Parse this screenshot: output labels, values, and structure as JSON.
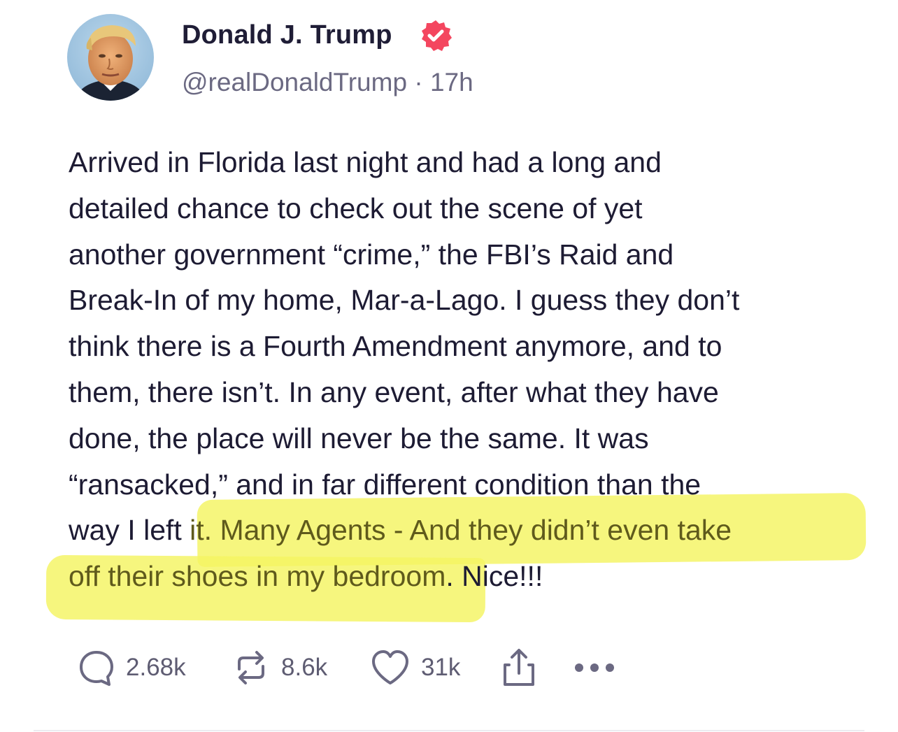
{
  "author": {
    "name": "Donald J. Trump",
    "handle": "@realDonaldTrump",
    "separator": "·",
    "time": "17h",
    "verified": true,
    "avatar": "profile-photo"
  },
  "post": {
    "lines": [
      "Arrived in Florida last night and had a long and",
      "detailed chance to check out the scene of yet",
      "another government “crime,” the FBI’s Raid and",
      "Break-In of my home, Mar-a-Lago. I guess they don’t",
      "think there is a Fourth Amendment anymore, and to",
      "them, there isn’t. In any event, after what they have",
      "done, the place will never be the same. It was",
      "“ransacked,” and in far different condition than the"
    ],
    "line9_plain": "way I left ",
    "line9_highlight": "it. Many Agents - And they didn’t even take",
    "line10_highlight": "off their shoes in my bedroom",
    "line10_plain": ". Nice!!!",
    "highlight_color": "#f4f462"
  },
  "actions": {
    "reply": {
      "icon": "reply-bubble-icon",
      "count": "2.68k"
    },
    "repost": {
      "icon": "repost-icon",
      "count": "8.6k"
    },
    "like": {
      "icon": "heart-icon",
      "count": "31k"
    },
    "share": {
      "icon": "share-icon"
    },
    "more": {
      "icon": "more-dots-icon"
    }
  },
  "colors": {
    "text": "#1d1b33",
    "muted": "#6b6982",
    "verified_badge": "#f4465f"
  }
}
